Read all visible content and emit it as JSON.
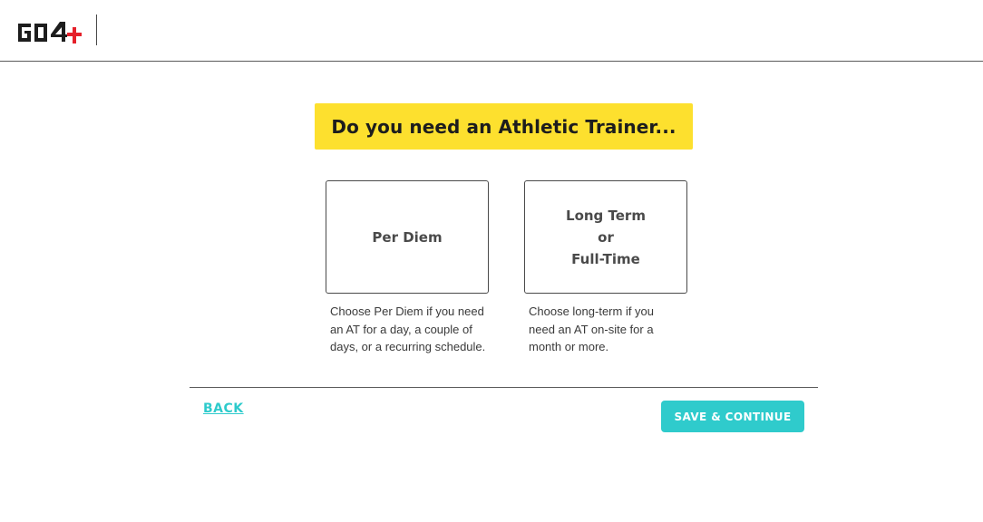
{
  "header": {
    "logo_text": "GO4"
  },
  "question": {
    "title": "Do you need an Athletic Trainer..."
  },
  "options": [
    {
      "label": "Per Diem",
      "description": "Choose Per Diem if you need an AT for a day, a couple of days, or a recurring schedule."
    },
    {
      "label": "Long Term\nor\nFull-Time",
      "description": "Choose long-term if you need an AT on-site for a month or more."
    }
  ],
  "footer": {
    "back_label": "BACK",
    "continue_label": "SAVE & CONTINUE"
  },
  "colors": {
    "accent": "#2fcbcc",
    "banner": "#fde02e",
    "logo_plus": "#e5202a"
  }
}
